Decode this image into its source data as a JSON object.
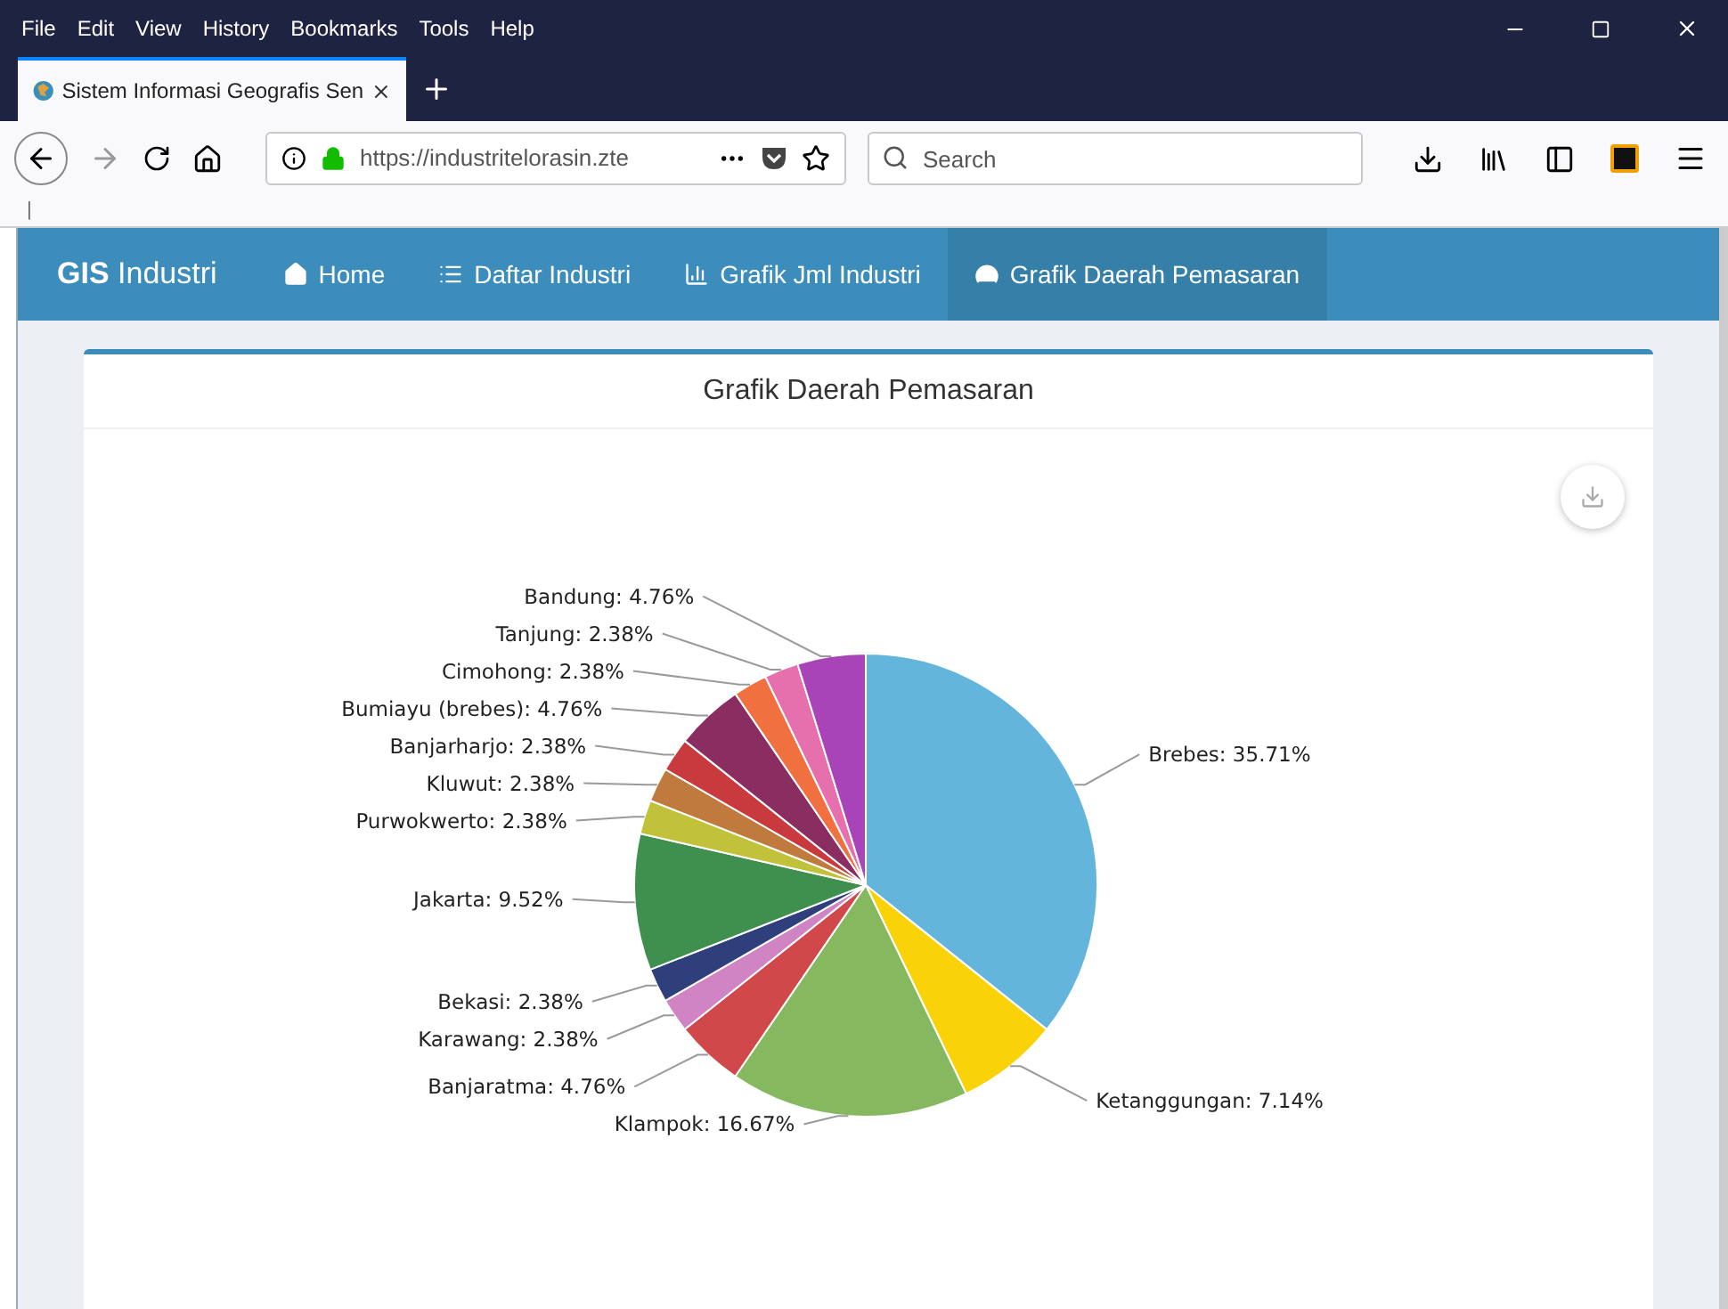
{
  "browser": {
    "menu": [
      "File",
      "Edit",
      "View",
      "History",
      "Bookmarks",
      "Tools",
      "Help"
    ],
    "tab": {
      "title": "Sistem Informasi Geografis Sen"
    },
    "address": {
      "url": "https://industritelorasin.zte"
    },
    "search": {
      "placeholder": "Search"
    },
    "status_text": "|"
  },
  "navbar": {
    "brand": "**GIS** Industri",
    "items": [
      {
        "label": "Home",
        "selected": false
      },
      {
        "label": "Daftar Industri",
        "selected": false
      },
      {
        "label": "Grafik Jml Industri",
        "selected": false
      },
      {
        "label": "Grafik Daerah Pemasaran",
        "selected": true
      }
    ]
  },
  "card": {
    "title": "Grafik Daerah Pemasaran",
    "chart_data": {
      "type": "pie",
      "series": [
        {
          "values": [
            35.71,
            7.14,
            16.67,
            4.76,
            2.38,
            2.38,
            9.52,
            2.38,
            2.38,
            2.38,
            4.76,
            2.38,
            2.38,
            4.76
          ],
          "colors": [
            "#64b5dc",
            "#f9d208",
            "#85b85f",
            "#d0484a",
            "#d084c4",
            "#2f3f7c",
            "#3f8f4f",
            "#c2c23a",
            "#c07a3e",
            "#c93a3e",
            "#8a2e62",
            "#f07040",
            "#e66fae",
            "#a944b8"
          ]
        }
      ],
      "value_labels": [
        "Brebes: 35.71%",
        "Ketanggungan: 7.14%",
        "Klampok: 16.67%",
        "Banjaratma: 4.76%",
        "Karawang: 2.38%",
        "Bekasi: 2.38%",
        "Jakarta: 9.52%",
        "Purwokwerto: 2.38%",
        "Kluwut: 2.38%",
        "Banjarharjo: 2.38%",
        "Bumiayu (brebes): 4.76%",
        "Cimohong: 2.38%",
        "Tanjung: 2.38%",
        "Bandung: 4.76%"
      ]
    }
  }
}
